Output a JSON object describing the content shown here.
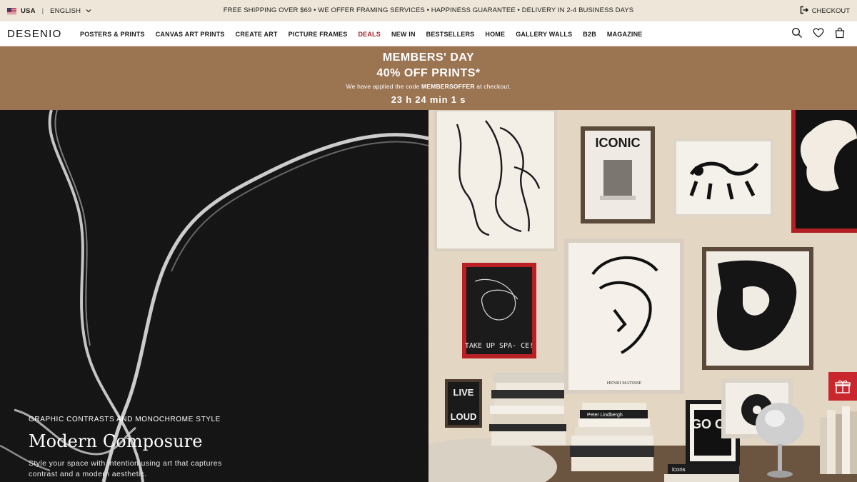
{
  "topbar": {
    "country": "USA",
    "language": "ENGLISH",
    "promo": "FREE SHIPPING OVER $69 • WE OFFER FRAMING SERVICES • HAPPINESS GUARANTEE • DELIVERY IN 2-4 BUSINESS DAYS",
    "checkout": "CHECKOUT"
  },
  "nav": {
    "logo": "DESENIO",
    "items": [
      {
        "label": "POSTERS & PRINTS"
      },
      {
        "label": "CANVAS ART PRINTS"
      },
      {
        "label": "CREATE ART"
      },
      {
        "label": "PICTURE FRAMES"
      },
      {
        "label": "DEALS"
      },
      {
        "label": "NEW IN"
      },
      {
        "label": "BESTSELLERS"
      },
      {
        "label": "HOME"
      },
      {
        "label": "GALLERY WALLS"
      },
      {
        "label": "B2B"
      },
      {
        "label": "MAGAZINE"
      }
    ],
    "icons": [
      "search-icon",
      "heart-icon",
      "bag-icon"
    ]
  },
  "banner": {
    "line1": "MEMBERS' DAY",
    "line2": "40% OFF PRINTS*",
    "note_pre": "We have applied the code",
    "note_code": "MEMBERSOFFER",
    "note_post": "at checkout.",
    "countdown": "23 h 24 min 1 s"
  },
  "hero": {
    "kicker": "GRAPHIC CONTRASTS AND MONOCHROME STYLE",
    "title": "Modern Composure",
    "description": "Style your space with intention using art that captures contrast and a modern aesthetic."
  },
  "gallery": {
    "iconic_label": "ICONIC",
    "takeup_label": "TAKE UP SPA- CE!",
    "live_label": "LIVE",
    "loud_label": "LOUD",
    "good_label": "GO OD",
    "matisse_caption": "HENRI MATISSE",
    "book_label": "Peter Lindbergh",
    "icons_label": "icons"
  },
  "colors": {
    "banner": "#9b7451",
    "topbar": "#eee6d8",
    "deals": "#a8232a",
    "gift_tab": "#c8272d"
  }
}
